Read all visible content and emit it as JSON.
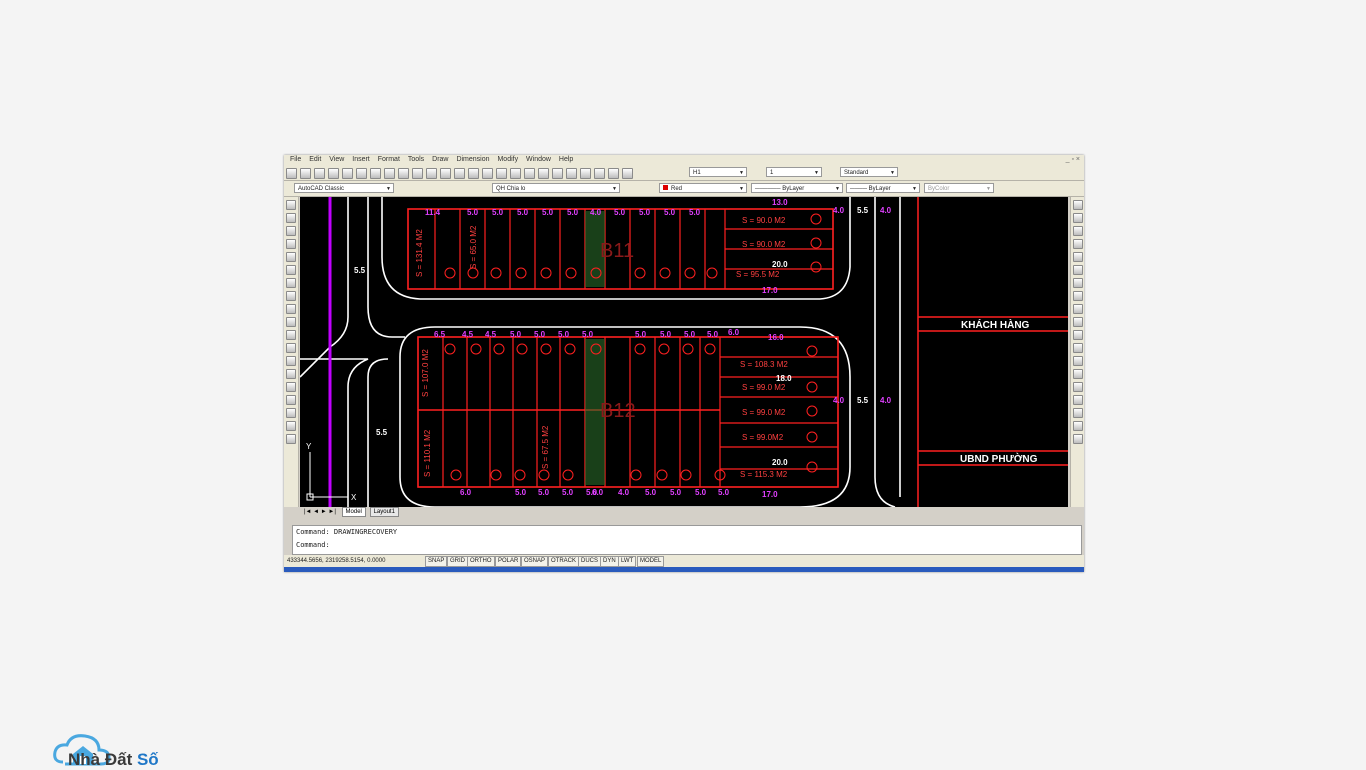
{
  "menu": [
    "File",
    "Edit",
    "View",
    "Insert",
    "Format",
    "Tools",
    "Draw",
    "Dimension",
    "Modify",
    "Window",
    "Help"
  ],
  "toolbar": {
    "text_style": "H1",
    "scale": "1",
    "table_style": "Standard",
    "workspace": "AutoCAD Classic",
    "layer": "QH Chia lo",
    "color": "Red",
    "linetype": "ByLayer",
    "lineweight": "ByLayer",
    "plotstyle": "ByColor"
  },
  "drawing": {
    "labels": {
      "khach_hang": "KHÁCH HÀNG",
      "ubnd": "UBND PHƯỜNG",
      "block1": "B11",
      "block2": "B12"
    },
    "block1_areas": [
      "S = 90.0 M2",
      "S = 90.0 M2",
      "S = 95.5 M2",
      "S = 131.4 M2"
    ],
    "block2_areas": [
      "S = 108.3 M2",
      "S = 99.0 M2",
      "S = 99.0 M2",
      "S = 99.0M2",
      "S = 115.3 M2",
      "S = 107.0 M2",
      "S = 110.1 M2"
    ],
    "dims_top": [
      "11.4",
      "5.0",
      "5.0",
      "5.0",
      "5.0",
      "5.0",
      "4.0",
      "5.0",
      "5.0",
      "5.0",
      "5.0",
      "13.0",
      "20.0",
      "17.0"
    ],
    "dims_mid": [
      "6.5",
      "4.5",
      "4.5",
      "5.0",
      "5.0",
      "5.0",
      "5.0",
      "5.0",
      "5.0",
      "5.0",
      "5.0",
      "6.0",
      "16.0",
      "18.0"
    ],
    "dims_bot": [
      "6.0",
      "5.0",
      "5.0",
      "5.0",
      "5.0",
      "6.0",
      "4.0",
      "5.0",
      "5.0",
      "5.0",
      "5.0",
      "20.0",
      "17.0"
    ],
    "road_dims": [
      "5.5",
      "5.5",
      "4.0",
      "5.5",
      "4.0",
      "5.5",
      "4.0",
      "4.0",
      "5.5"
    ],
    "lot_area_vertical": "S = 65.0 M2",
    "lot_area_vertical2": "S = 67.5 M2"
  },
  "tabs": [
    "Model",
    "Layout1"
  ],
  "command": {
    "line1": "Command: DRAWINGRECOVERY",
    "line2": "Command:"
  },
  "status": {
    "coords": "433344.5656, 2319258.5154, 0.0000",
    "buttons": [
      "SNAP",
      "GRID",
      "ORTHO",
      "POLAR",
      "OSNAP",
      "OTRACK",
      "DUCS",
      "DYN",
      "LWT",
      "MODEL"
    ]
  },
  "brand": {
    "name_part1": "Nhà Đất ",
    "name_part2": "Số"
  }
}
